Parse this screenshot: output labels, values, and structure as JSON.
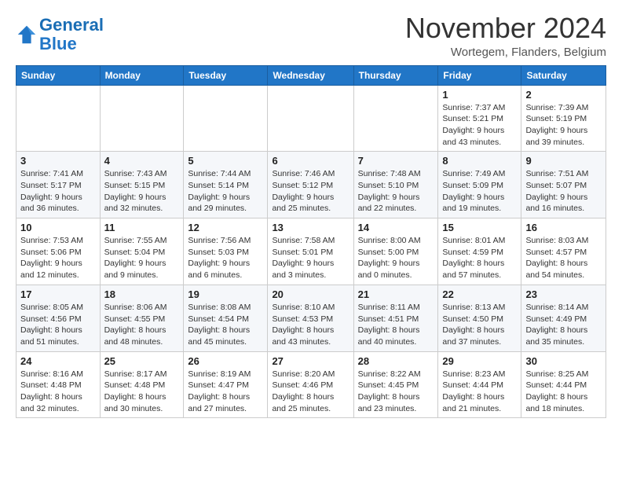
{
  "logo": {
    "line1": "General",
    "line2": "Blue"
  },
  "title": "November 2024",
  "location": "Wortegem, Flanders, Belgium",
  "days_of_week": [
    "Sunday",
    "Monday",
    "Tuesday",
    "Wednesday",
    "Thursday",
    "Friday",
    "Saturday"
  ],
  "weeks": [
    [
      {
        "day": "",
        "info": ""
      },
      {
        "day": "",
        "info": ""
      },
      {
        "day": "",
        "info": ""
      },
      {
        "day": "",
        "info": ""
      },
      {
        "day": "",
        "info": ""
      },
      {
        "day": "1",
        "info": "Sunrise: 7:37 AM\nSunset: 5:21 PM\nDaylight: 9 hours\nand 43 minutes."
      },
      {
        "day": "2",
        "info": "Sunrise: 7:39 AM\nSunset: 5:19 PM\nDaylight: 9 hours\nand 39 minutes."
      }
    ],
    [
      {
        "day": "3",
        "info": "Sunrise: 7:41 AM\nSunset: 5:17 PM\nDaylight: 9 hours\nand 36 minutes."
      },
      {
        "day": "4",
        "info": "Sunrise: 7:43 AM\nSunset: 5:15 PM\nDaylight: 9 hours\nand 32 minutes."
      },
      {
        "day": "5",
        "info": "Sunrise: 7:44 AM\nSunset: 5:14 PM\nDaylight: 9 hours\nand 29 minutes."
      },
      {
        "day": "6",
        "info": "Sunrise: 7:46 AM\nSunset: 5:12 PM\nDaylight: 9 hours\nand 25 minutes."
      },
      {
        "day": "7",
        "info": "Sunrise: 7:48 AM\nSunset: 5:10 PM\nDaylight: 9 hours\nand 22 minutes."
      },
      {
        "day": "8",
        "info": "Sunrise: 7:49 AM\nSunset: 5:09 PM\nDaylight: 9 hours\nand 19 minutes."
      },
      {
        "day": "9",
        "info": "Sunrise: 7:51 AM\nSunset: 5:07 PM\nDaylight: 9 hours\nand 16 minutes."
      }
    ],
    [
      {
        "day": "10",
        "info": "Sunrise: 7:53 AM\nSunset: 5:06 PM\nDaylight: 9 hours\nand 12 minutes."
      },
      {
        "day": "11",
        "info": "Sunrise: 7:55 AM\nSunset: 5:04 PM\nDaylight: 9 hours\nand 9 minutes."
      },
      {
        "day": "12",
        "info": "Sunrise: 7:56 AM\nSunset: 5:03 PM\nDaylight: 9 hours\nand 6 minutes."
      },
      {
        "day": "13",
        "info": "Sunrise: 7:58 AM\nSunset: 5:01 PM\nDaylight: 9 hours\nand 3 minutes."
      },
      {
        "day": "14",
        "info": "Sunrise: 8:00 AM\nSunset: 5:00 PM\nDaylight: 9 hours\nand 0 minutes."
      },
      {
        "day": "15",
        "info": "Sunrise: 8:01 AM\nSunset: 4:59 PM\nDaylight: 8 hours\nand 57 minutes."
      },
      {
        "day": "16",
        "info": "Sunrise: 8:03 AM\nSunset: 4:57 PM\nDaylight: 8 hours\nand 54 minutes."
      }
    ],
    [
      {
        "day": "17",
        "info": "Sunrise: 8:05 AM\nSunset: 4:56 PM\nDaylight: 8 hours\nand 51 minutes."
      },
      {
        "day": "18",
        "info": "Sunrise: 8:06 AM\nSunset: 4:55 PM\nDaylight: 8 hours\nand 48 minutes."
      },
      {
        "day": "19",
        "info": "Sunrise: 8:08 AM\nSunset: 4:54 PM\nDaylight: 8 hours\nand 45 minutes."
      },
      {
        "day": "20",
        "info": "Sunrise: 8:10 AM\nSunset: 4:53 PM\nDaylight: 8 hours\nand 43 minutes."
      },
      {
        "day": "21",
        "info": "Sunrise: 8:11 AM\nSunset: 4:51 PM\nDaylight: 8 hours\nand 40 minutes."
      },
      {
        "day": "22",
        "info": "Sunrise: 8:13 AM\nSunset: 4:50 PM\nDaylight: 8 hours\nand 37 minutes."
      },
      {
        "day": "23",
        "info": "Sunrise: 8:14 AM\nSunset: 4:49 PM\nDaylight: 8 hours\nand 35 minutes."
      }
    ],
    [
      {
        "day": "24",
        "info": "Sunrise: 8:16 AM\nSunset: 4:48 PM\nDaylight: 8 hours\nand 32 minutes."
      },
      {
        "day": "25",
        "info": "Sunrise: 8:17 AM\nSunset: 4:48 PM\nDaylight: 8 hours\nand 30 minutes."
      },
      {
        "day": "26",
        "info": "Sunrise: 8:19 AM\nSunset: 4:47 PM\nDaylight: 8 hours\nand 27 minutes."
      },
      {
        "day": "27",
        "info": "Sunrise: 8:20 AM\nSunset: 4:46 PM\nDaylight: 8 hours\nand 25 minutes."
      },
      {
        "day": "28",
        "info": "Sunrise: 8:22 AM\nSunset: 4:45 PM\nDaylight: 8 hours\nand 23 minutes."
      },
      {
        "day": "29",
        "info": "Sunrise: 8:23 AM\nSunset: 4:44 PM\nDaylight: 8 hours\nand 21 minutes."
      },
      {
        "day": "30",
        "info": "Sunrise: 8:25 AM\nSunset: 4:44 PM\nDaylight: 8 hours\nand 18 minutes."
      }
    ]
  ]
}
